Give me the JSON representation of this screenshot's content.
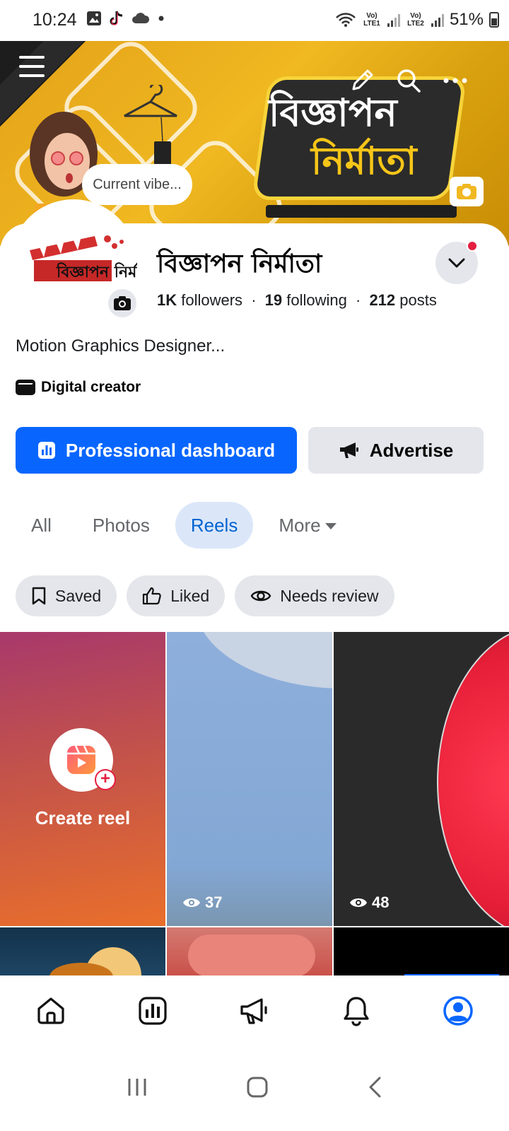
{
  "status_bar": {
    "time": "10:24",
    "left_icons": [
      "gallery-icon",
      "tiktok-icon",
      "cloud-icon",
      "dot-icon"
    ],
    "sim1": "Vo) LTE1",
    "sim2": "Vo) LTE2",
    "battery": "51%"
  },
  "cover": {
    "brand_line1": "বিজ্ঞাপন",
    "brand_line2": "নির্মাতা",
    "bubble": "Current vibe..."
  },
  "profile": {
    "name": "বিজ্ঞাপন নির্মাতা",
    "logo_text": "বিজ্ঞাপন নির্মাতা",
    "followers_count": "1K",
    "followers_label": "followers",
    "following_count": "19",
    "following_label": "following",
    "posts_count": "212",
    "posts_label": "posts",
    "separator": "·",
    "bio": "Motion Graphics Designer...",
    "category": "Digital creator"
  },
  "buttons": {
    "professional": "Professional dashboard",
    "advertise": "Advertise"
  },
  "tabs": [
    {
      "label": "All",
      "active": false
    },
    {
      "label": "Photos",
      "active": false
    },
    {
      "label": "Reels",
      "active": true
    },
    {
      "label": "More",
      "active": false
    }
  ],
  "chips": [
    {
      "label": "Saved",
      "icon": "bookmark-icon"
    },
    {
      "label": "Liked",
      "icon": "thumbs-up-icon"
    },
    {
      "label": "Needs review",
      "icon": "eye-icon"
    }
  ],
  "grid": {
    "create_label": "Create reel",
    "views": [
      "37",
      "48"
    ]
  },
  "bottom_nav": [
    "home-icon",
    "dashboard-icon",
    "megaphone-icon",
    "bell-icon",
    "profile-icon"
  ],
  "colors": {
    "primary": "#0866ff",
    "tab_active_bg": "#dbe7f9",
    "tab_active_text": "#0064d1",
    "notification": "#e41e3f"
  }
}
